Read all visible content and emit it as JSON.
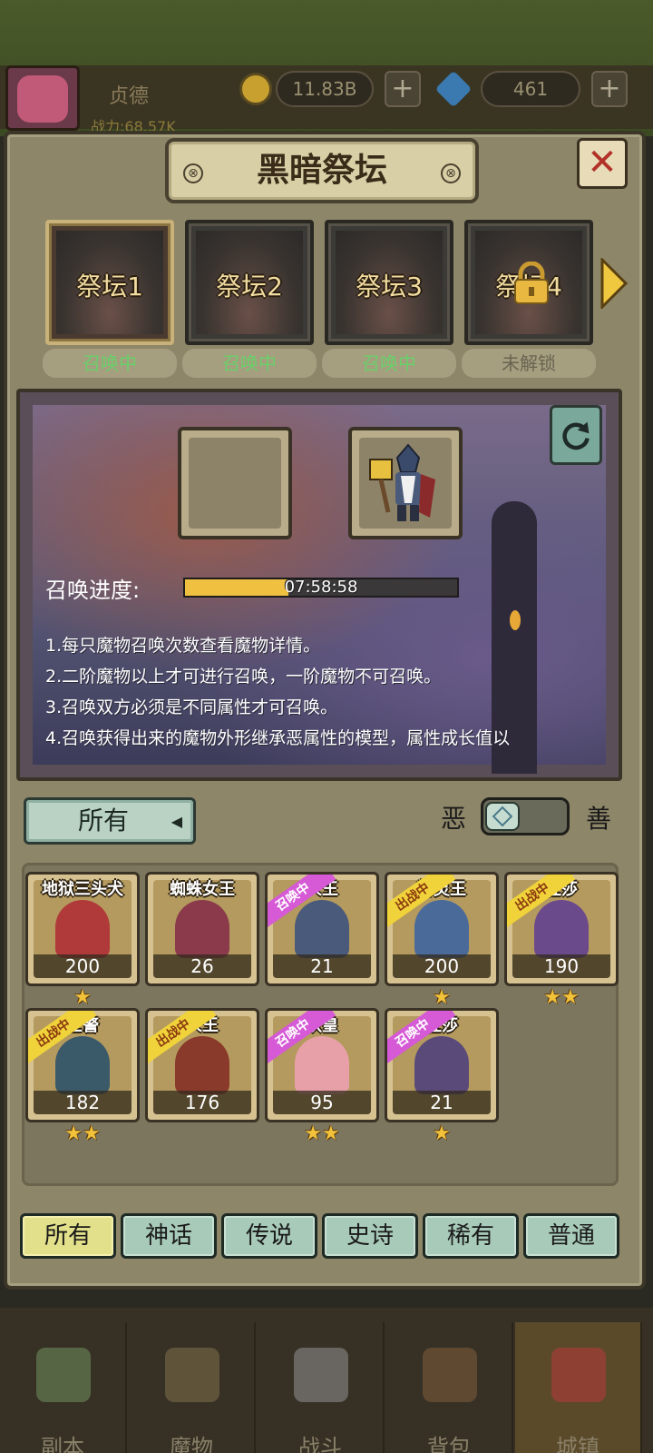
{
  "header": {
    "player_name": "贞德",
    "power_text": "战力:68.57K",
    "gold": "11.83B",
    "gems": "461"
  },
  "dialog": {
    "title": "黑暗祭坛",
    "close": "✕"
  },
  "altars": [
    {
      "label": "祭坛1",
      "status": "召唤中",
      "locked": false,
      "selected": true
    },
    {
      "label": "祭坛2",
      "status": "召唤中",
      "locked": false,
      "selected": false
    },
    {
      "label": "祭坛3",
      "status": "召唤中",
      "locked": false,
      "selected": false
    },
    {
      "label": "祭坛4",
      "status": "未解锁",
      "locked": true,
      "selected": false
    }
  ],
  "summon": {
    "progress_label": "召唤进度:",
    "progress_time": "07:58:58",
    "progress_fraction": 0.38,
    "rules": [
      "1.每只魔物召唤次数查看魔物详情。",
      "2.二阶魔物以上才可进行召唤，一阶魔物不可召唤。",
      "3.召唤双方必须是不同属性才可召唤。",
      "4.召唤获得出来的魔物外形继承恶属性的模型，属性成长值以"
    ]
  },
  "filter": {
    "selected": "所有",
    "evil_label": "恶",
    "good_label": "善"
  },
  "monsters": [
    {
      "name": "地狱三头犬",
      "count": "200",
      "stars": "★",
      "ribbon": "",
      "color": "#b03a3a"
    },
    {
      "name": "蜘蛛女王",
      "count": "26",
      "stars": "",
      "ribbon": "",
      "color": "#8a3a4a"
    },
    {
      "name": "人王",
      "count": "21",
      "stars": "",
      "ribbon": "召唤中",
      "color": "#4a5a7a"
    },
    {
      "name": "精灵王",
      "count": "200",
      "stars": "★",
      "ribbon": "出战中",
      "color": "#4a6a9a"
    },
    {
      "name": "杜莎",
      "count": "190",
      "stars": "★★",
      "ribbon": "出战中",
      "color": "#6a4a8a"
    },
    {
      "name": "上警",
      "count": "182",
      "stars": "★★",
      "ribbon": "出战中",
      "color": "#3a5a6a"
    },
    {
      "name": "人王",
      "count": "176",
      "stars": "",
      "ribbon": "出战中",
      "color": "#8a3a2a"
    },
    {
      "name": "妖皇",
      "count": "95",
      "stars": "★★",
      "ribbon": "召唤中",
      "color": "#e8a0a8"
    },
    {
      "name": "杜莎",
      "count": "21",
      "stars": "★",
      "ribbon": "召唤中",
      "color": "#5a4a7a"
    }
  ],
  "rarity_tabs": [
    {
      "label": "所有",
      "active": true
    },
    {
      "label": "神话",
      "active": false
    },
    {
      "label": "传说",
      "active": false
    },
    {
      "label": "史诗",
      "active": false
    },
    {
      "label": "稀有",
      "active": false
    },
    {
      "label": "普通",
      "active": false
    }
  ],
  "bottom_nav": [
    {
      "label": "副本",
      "active": false,
      "color": "#6a8a5a"
    },
    {
      "label": "魔物",
      "active": false,
      "color": "#7a6a4a"
    },
    {
      "label": "战斗",
      "active": false,
      "color": "#8a8a8a"
    },
    {
      "label": "背包",
      "active": false,
      "color": "#7a5a3a"
    },
    {
      "label": "城镇",
      "active": true,
      "color": "#b03a3a"
    }
  ]
}
